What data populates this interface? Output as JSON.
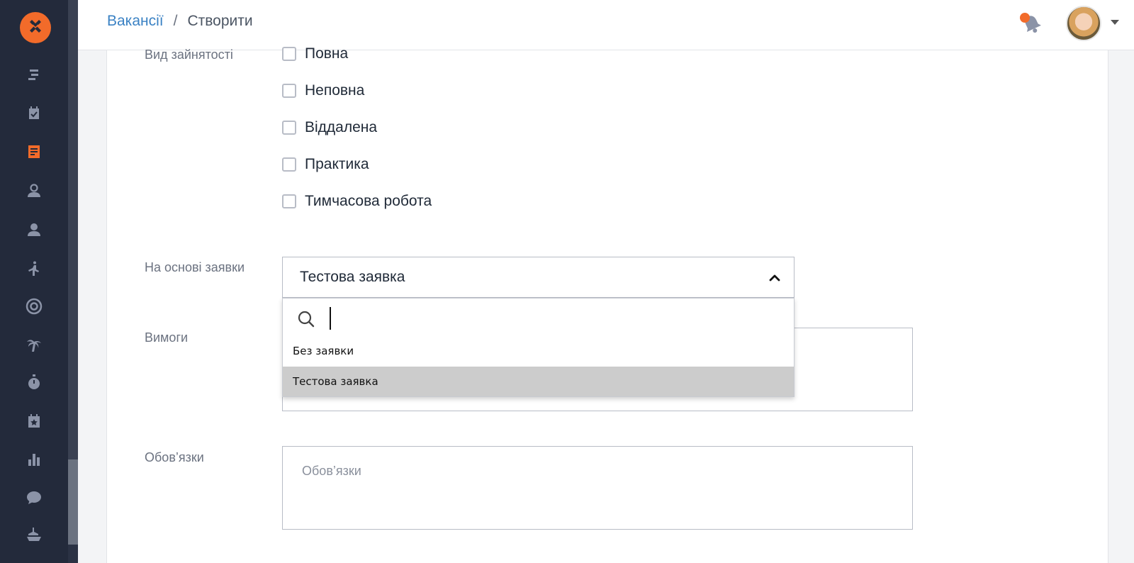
{
  "header": {
    "breadcrumb_link": "Вакансії",
    "breadcrumb_sep": "/",
    "breadcrumb_current": "Створити"
  },
  "sidebar": {
    "items": [
      {
        "icon": "stacked-bars-icon"
      },
      {
        "icon": "calendar-check-icon"
      },
      {
        "icon": "document-icon",
        "active": true
      },
      {
        "icon": "user-outline-icon"
      },
      {
        "icon": "user-icon"
      },
      {
        "icon": "yoga-icon"
      },
      {
        "icon": "target-icon"
      },
      {
        "icon": "palm-tree-icon"
      },
      {
        "icon": "stopwatch-icon"
      },
      {
        "icon": "calendar-star-icon"
      },
      {
        "icon": "bar-chart-icon"
      },
      {
        "icon": "chat-icon"
      },
      {
        "icon": "ship-icon"
      }
    ],
    "accent": "#f26b2a"
  },
  "form": {
    "employment": {
      "label": "Вид зайнятості",
      "options": [
        "Повна",
        "Неповна",
        "Віддалена",
        "Практика",
        "Тимчасова робота"
      ]
    },
    "request": {
      "label": "На основі заявки",
      "value": "Тестова заявка",
      "dropdown": {
        "search_value": "",
        "options": [
          "Без заявки",
          "Тестова заявка"
        ],
        "selected": "Тестова заявка"
      }
    },
    "requirements": {
      "label": "Вимоги"
    },
    "duties": {
      "label": "Обов’язки",
      "placeholder": "Обов’язки"
    }
  }
}
